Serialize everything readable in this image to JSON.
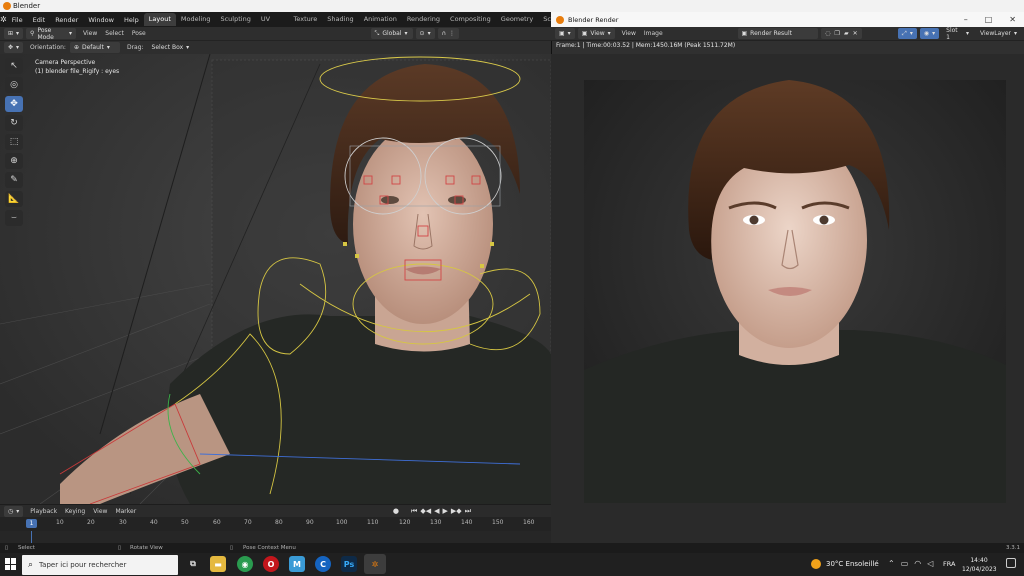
{
  "window": {
    "title": "Blender",
    "minimize": "–",
    "maximize": "□",
    "close": "✕"
  },
  "menu": {
    "items": [
      "File",
      "Edit",
      "Render",
      "Window",
      "Help"
    ],
    "workspaces": [
      "Layout",
      "Modeling",
      "Sculpting",
      "UV Editing",
      "Texture Paint",
      "Shading",
      "Animation",
      "Rendering",
      "Compositing",
      "Geometry Nodes",
      "Scriptin"
    ]
  },
  "header": {
    "mode": "Pose Mode",
    "view": "View",
    "select": "Select",
    "pose": "Pose",
    "transform_orientation": "Global",
    "orientation_label": "Orientation:",
    "orientation_value": "Default",
    "drag_label": "Drag:",
    "drag_value": "Select Box"
  },
  "viewport": {
    "camera_label": "Camera Perspective",
    "object_label": "(1) blender file_Rigify : eyes"
  },
  "timeline": {
    "menus": [
      "Playback",
      "Keying",
      "View",
      "Marker"
    ],
    "current_frame": "1",
    "ticks": [
      "10",
      "20",
      "30",
      "40",
      "50",
      "60",
      "70",
      "80",
      "90",
      "100",
      "110",
      "120",
      "130",
      "140",
      "150",
      "160"
    ]
  },
  "statusbar": {
    "select": "Select",
    "rotate": "Rotate View",
    "context": "Pose Context Menu",
    "version": "3.3.1"
  },
  "render_window": {
    "title": "Blender Render",
    "view": "View",
    "view2": "View",
    "image": "Image",
    "image_name": "Render Result",
    "slot": "Slot 1",
    "view_layer": "ViewLayer",
    "info": "Frame:1 | Time:00:03.52 | Mem:1450.16M (Peak 1511.72M)"
  },
  "taskbar": {
    "search_placeholder": "Taper ici pour rechercher",
    "weather": "30°C  Ensoleillé",
    "lang": "FRA",
    "time": "14:40",
    "date": "12/04/2023"
  },
  "colors": {
    "accent": "#4772b3",
    "blender_orange": "#e87d0d",
    "ui_dark": "#2e2e2e"
  }
}
